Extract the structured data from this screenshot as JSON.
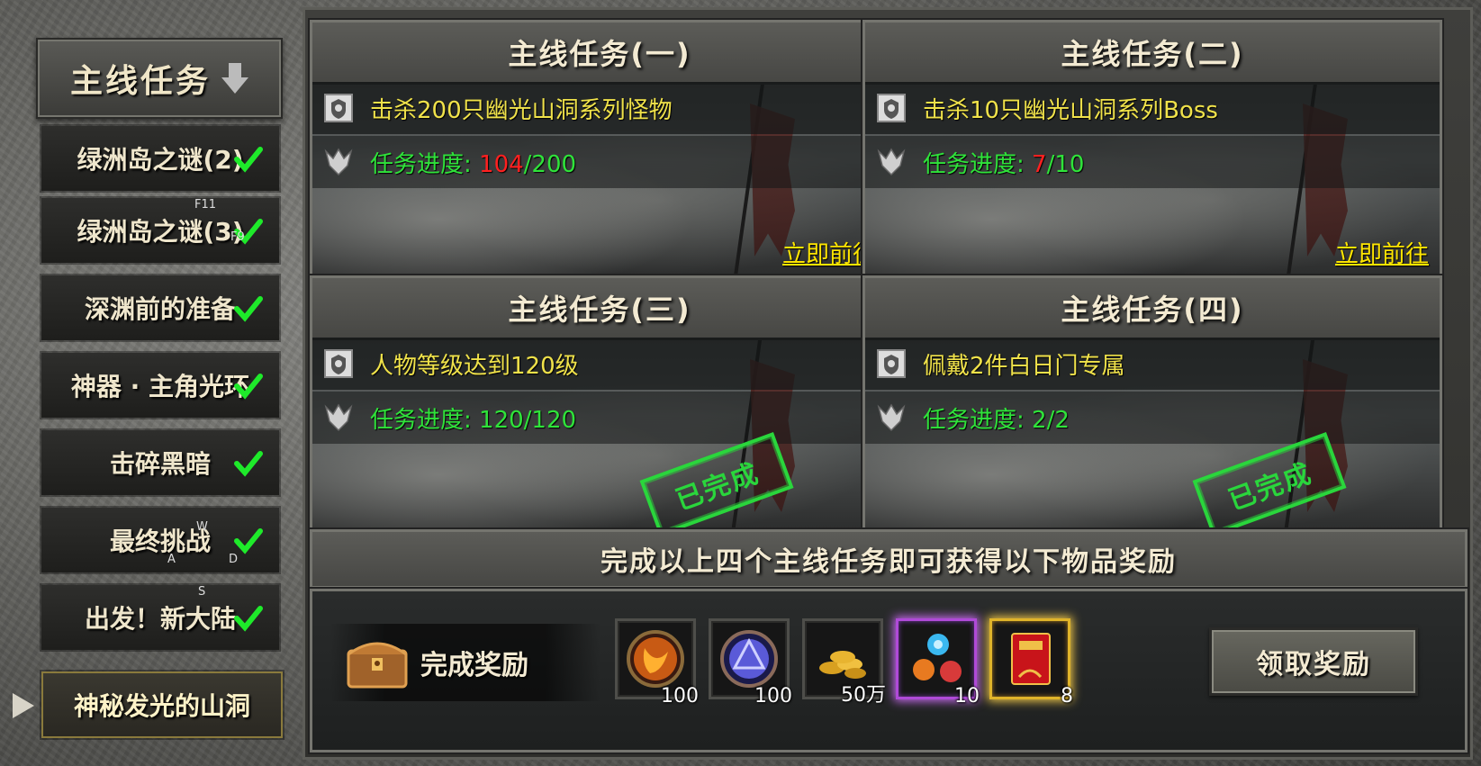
{
  "sidebar": {
    "header_title": "主线任务",
    "items": [
      {
        "label": "绿洲岛之谜(2)",
        "completed": true
      },
      {
        "label": "绿洲岛之谜(3)",
        "completed": true
      },
      {
        "label": "深渊前的准备",
        "completed": true
      },
      {
        "label": "神器 · 主角光环",
        "completed": true
      },
      {
        "label": "击碎黑暗",
        "completed": true
      },
      {
        "label": "最终挑战",
        "completed": true
      },
      {
        "label": "出发！新大陆",
        "completed": true
      },
      {
        "label": "神秘发光的山洞",
        "completed": false,
        "active": true
      }
    ],
    "key_hints": {
      "f11": "F11",
      "f9": "F9",
      "w": "W",
      "a": "A",
      "d": "D",
      "s": "S"
    }
  },
  "tasks": [
    {
      "title": "主线任务(一)",
      "objective": "击杀200只幽光山洞系列怪物",
      "progress_label": "任务进度: ",
      "progress_current": "104",
      "progress_total": "/200",
      "goto_label": "立即前往",
      "completed": false
    },
    {
      "title": "主线任务(二)",
      "objective": "击杀10只幽光山洞系列Boss",
      "progress_label": "任务进度: ",
      "progress_current": "7",
      "progress_total": "/10",
      "goto_label": "立即前往",
      "completed": false
    },
    {
      "title": "主线任务(三)",
      "objective": "人物等级达到120级",
      "progress_label": "任务进度: ",
      "progress_current": "120",
      "progress_total": "/120",
      "stamp_label": "已完成",
      "completed": true
    },
    {
      "title": "主线任务(四)",
      "objective": "佩戴2件白日门专属",
      "progress_label": "任务进度: ",
      "progress_current": "2",
      "progress_total": "/2",
      "stamp_label": "已完成",
      "completed": true
    }
  ],
  "reward": {
    "header": "完成以上四个主线任务即可获得以下物品奖励",
    "label": "完成奖励",
    "items": [
      {
        "icon": "fire-orb-icon",
        "qty": "100"
      },
      {
        "icon": "arcane-orb-icon",
        "qty": "100"
      },
      {
        "icon": "gold-coins-icon",
        "qty": "50万"
      },
      {
        "icon": "gem-cluster-icon",
        "qty": "10",
        "rarity": "purple"
      },
      {
        "icon": "red-book-icon",
        "qty": "8",
        "rarity": "gold"
      }
    ],
    "claim_button": "领取奖励"
  },
  "colors": {
    "progress_green": "#2fe33a",
    "progress_red": "#ff2020",
    "objective_yellow": "#f0e24a",
    "stamp_green": "#2ad63c",
    "link_yellow": "#ffe600"
  }
}
